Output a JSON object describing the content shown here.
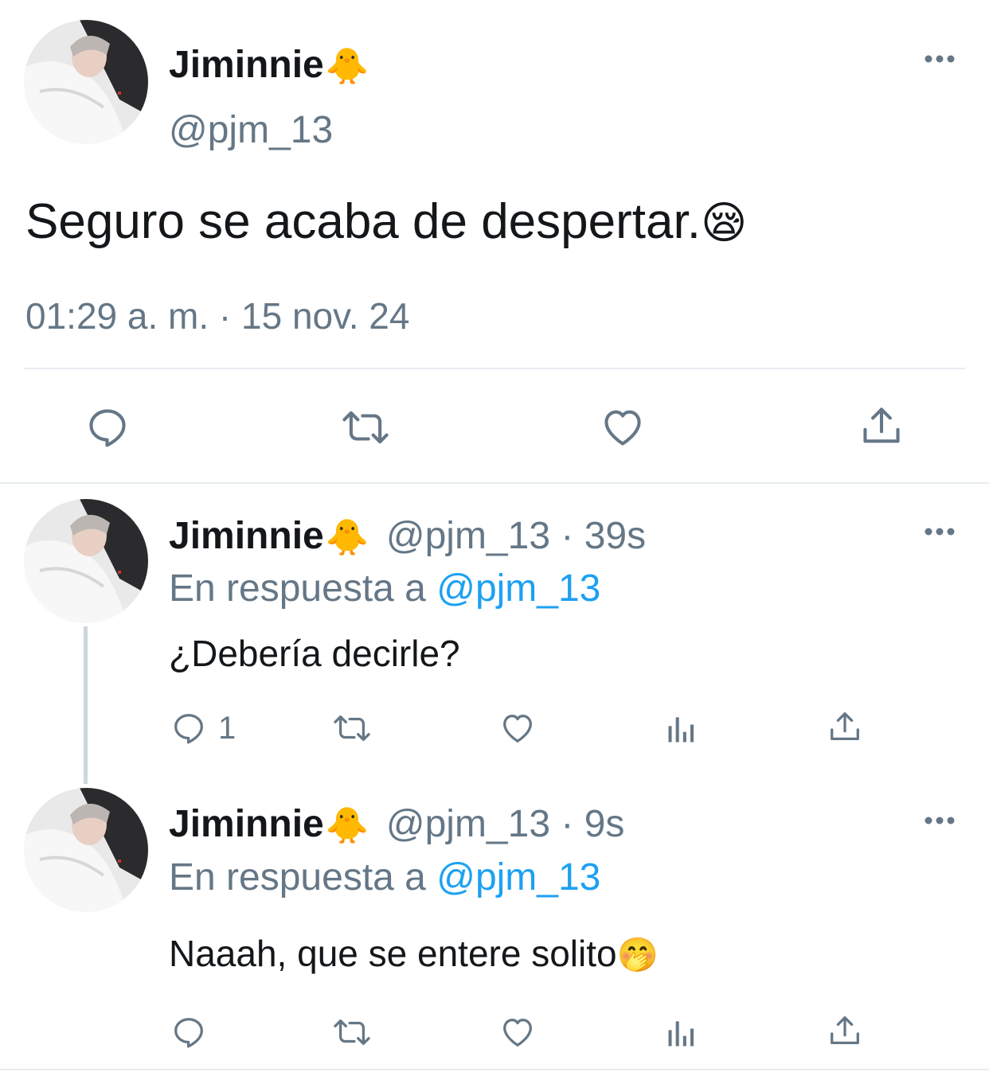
{
  "main_tweet": {
    "display_name": "Jiminnie",
    "name_emoji": "🐥",
    "handle": "@pjm_13",
    "text": "Seguro se acaba de despertar.",
    "text_emoji": "😪",
    "timestamp": "01:29 a. m. · 15 nov. 24"
  },
  "replies": [
    {
      "display_name": "Jiminnie",
      "name_emoji": "🐥",
      "handle": "@pjm_13",
      "time": "39s",
      "reply_prefix": "En respuesta a",
      "reply_to": "@pjm_13",
      "text": "¿Debería decirle?",
      "text_emoji": "",
      "reply_count": "1"
    },
    {
      "display_name": "Jiminnie",
      "name_emoji": "🐥",
      "handle": "@pjm_13",
      "time": "9s",
      "reply_prefix": "En respuesta a",
      "reply_to": "@pjm_13",
      "text": "Naaah, que se entere solito",
      "text_emoji": "🤭",
      "reply_count": ""
    }
  ],
  "separator": "·",
  "icons": [
    "more-icon",
    "reply-icon",
    "retweet-icon",
    "like-icon",
    "share-icon",
    "analytics-icon"
  ],
  "colors": {
    "text": "#14171a",
    "secondary": "#657786",
    "link": "#1da1f2",
    "divider": "#e6ecf0"
  }
}
